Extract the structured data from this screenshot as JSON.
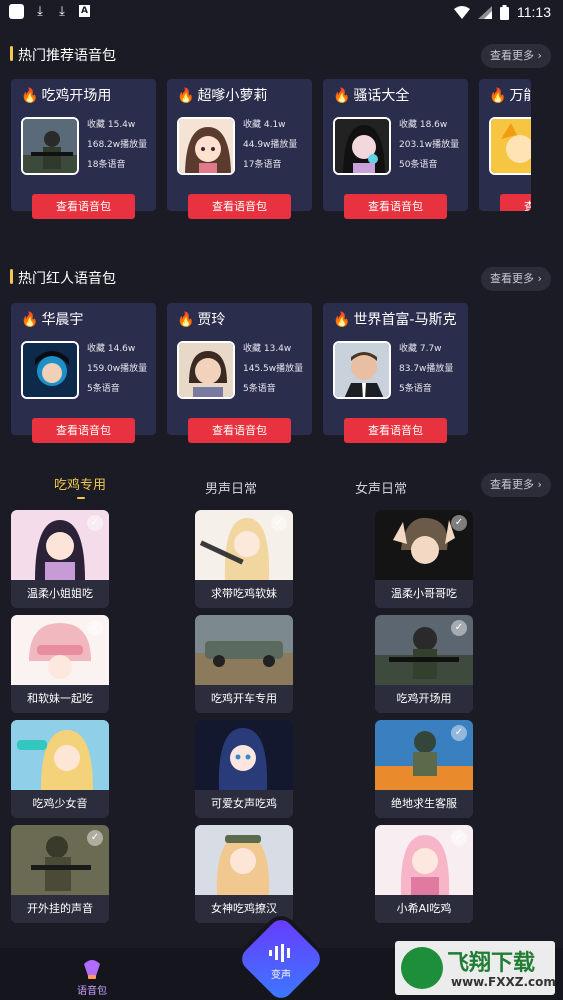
{
  "status_bar": {
    "time": "11:13"
  },
  "sections": {
    "hot_packs": {
      "title": "热门推荐语音包",
      "more": "查看更多",
      "cards": [
        {
          "name": "吃鸡开场用",
          "fav": "收藏 15.4w",
          "plays": "168.2w播放量",
          "count": "18条语音",
          "button": "查看语音包"
        },
        {
          "name": "超嗲小萝莉",
          "fav": "收藏 4.1w",
          "plays": "44.9w播放量",
          "count": "17条语音",
          "button": "查看语音包"
        },
        {
          "name": "骚话大全",
          "fav": "收藏 18.6w",
          "plays": "203.1w播放量",
          "count": "50条语音",
          "button": "查看语音包"
        },
        {
          "name": "万能游戏",
          "button": "查看语音包"
        }
      ]
    },
    "celebrity_packs": {
      "title": "热门红人语音包",
      "more": "查看更多",
      "cards": [
        {
          "name": "华晨宇",
          "fav": "收藏 14.6w",
          "plays": "159.0w播放量",
          "count": "5条语音",
          "button": "查看语音包"
        },
        {
          "name": "贾玲",
          "fav": "收藏 13.4w",
          "plays": "145.5w播放量",
          "count": "5条语音",
          "button": "查看语音包"
        },
        {
          "name": "世界首富-马斯克",
          "fav": "收藏 7.7w",
          "plays": "83.7w播放量",
          "count": "5条语音",
          "button": "查看语音包"
        }
      ]
    }
  },
  "tabs": {
    "items": [
      "吃鸡专用",
      "男声日常",
      "女声日常"
    ],
    "active": 0,
    "more": "查看更多"
  },
  "voices": [
    "温柔小姐姐吃",
    "求带吃鸡软妹",
    "温柔小哥哥吃",
    "和软妹一起吃",
    "吃鸡开车专用",
    "吃鸡开场用",
    "吃鸡少女音",
    "可爱女声吃鸡",
    "绝地求生客服",
    "开外挂的声音",
    "女神吃鸡撩汉",
    "小希AI吃鸡"
  ],
  "bottom_nav": {
    "left": "语音包",
    "center": "变声"
  },
  "watermark": {
    "big": "飞翔下载",
    "url": "www.FXXZ.com"
  },
  "colors": {
    "accent": "#f2c94c",
    "button_red": "#e8323f",
    "card_bg": "#2b2d4d",
    "page_bg": "#1b1b25"
  }
}
